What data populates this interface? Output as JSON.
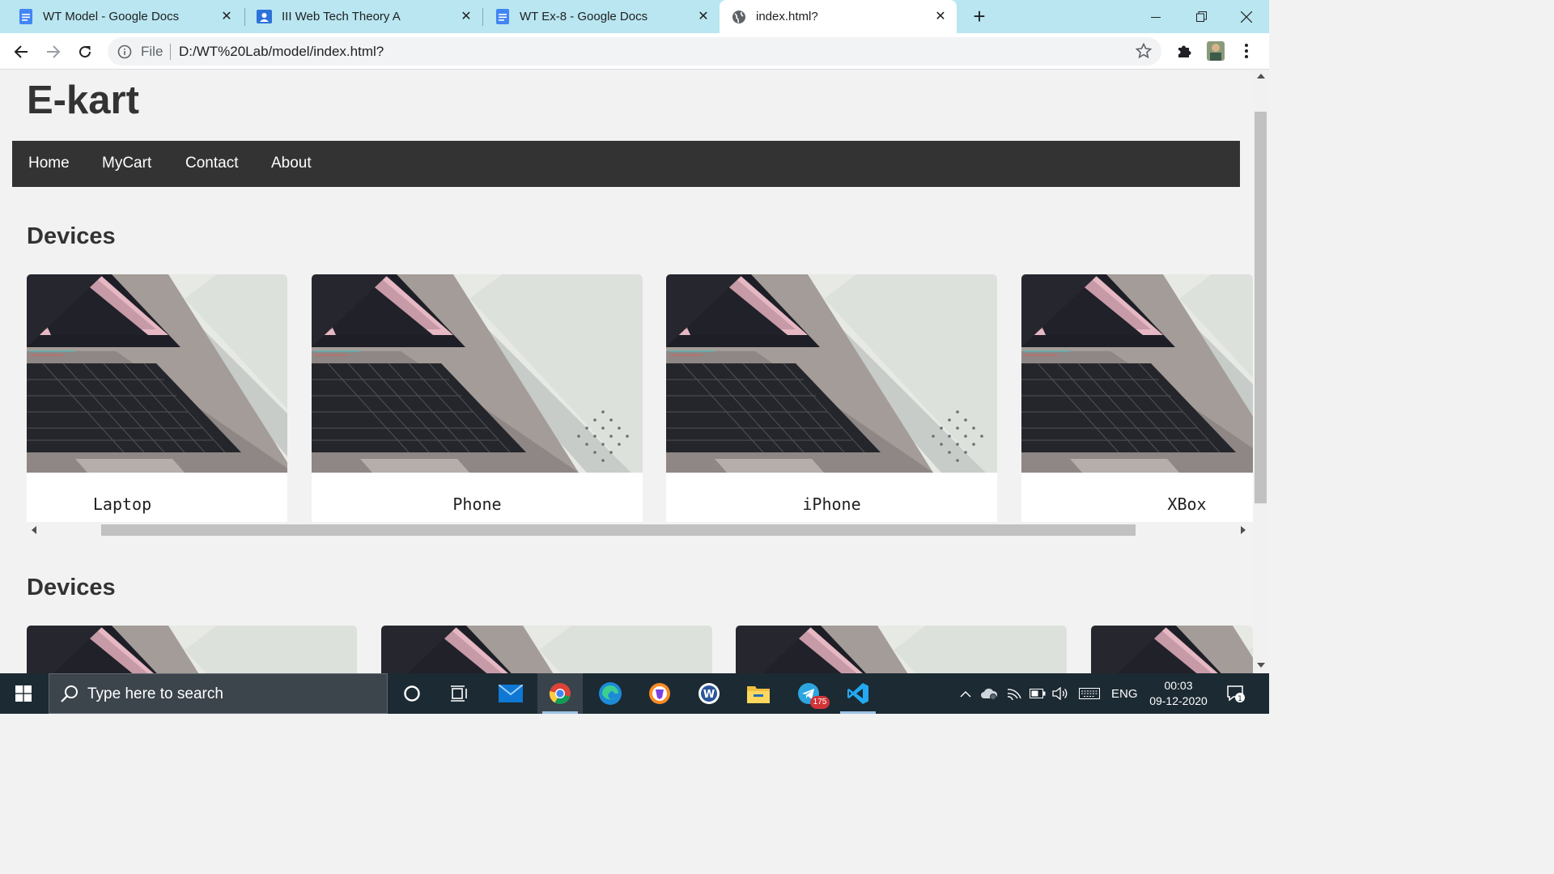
{
  "browser": {
    "tabs": [
      {
        "label": "WT Model - Google Docs",
        "icon": "google-docs-icon",
        "active": false
      },
      {
        "label": "III Web Tech Theory A",
        "icon": "google-classroom-icon",
        "active": false
      },
      {
        "label": "WT Ex-8 - Google Docs",
        "icon": "google-docs-icon",
        "active": false
      },
      {
        "label": "index.html?",
        "icon": "globe-icon",
        "active": true
      }
    ],
    "address": {
      "scheme_label": "File",
      "url": "D:/WT%20Lab/model/index.html?"
    },
    "colors": {
      "tabstrip": "#b9e6f0",
      "toolbar": "#ffffff"
    }
  },
  "page": {
    "site_title": "E-kart",
    "nav": [
      {
        "label": "Home"
      },
      {
        "label": "MyCart"
      },
      {
        "label": "Contact"
      },
      {
        "label": "About"
      }
    ],
    "sections": [
      {
        "title": "Devices",
        "cards": [
          {
            "name": "Laptop",
            "image": "laptop-photo"
          },
          {
            "name": "Phone",
            "image": "laptop-photo"
          },
          {
            "name": "iPhone",
            "image": "laptop-photo"
          },
          {
            "name": "XBox",
            "image": "laptop-photo"
          }
        ]
      },
      {
        "title": "Devices",
        "cards": [
          {
            "name": "",
            "image": "laptop-photo"
          },
          {
            "name": "",
            "image": "laptop-photo"
          },
          {
            "name": "",
            "image": "laptop-photo"
          },
          {
            "name": "",
            "image": "laptop-photo"
          }
        ]
      }
    ],
    "colors": {
      "background": "#f2f2f2",
      "navbar": "#333333",
      "title": "#333333"
    }
  },
  "taskbar": {
    "search_placeholder": "Type here to search",
    "apps": [
      {
        "icon": "cortana-icon"
      },
      {
        "icon": "task-view-icon"
      },
      {
        "icon": "mail-icon"
      },
      {
        "icon": "chrome-icon",
        "active": true
      },
      {
        "icon": "edge-icon"
      },
      {
        "icon": "brave-icon"
      },
      {
        "icon": "word-icon"
      },
      {
        "icon": "file-explorer-icon"
      },
      {
        "icon": "telegram-icon",
        "badge": "175"
      },
      {
        "icon": "vscode-icon"
      }
    ],
    "language": "ENG",
    "time": "00:03",
    "date": "09-12-2020",
    "notification_count": "1"
  }
}
